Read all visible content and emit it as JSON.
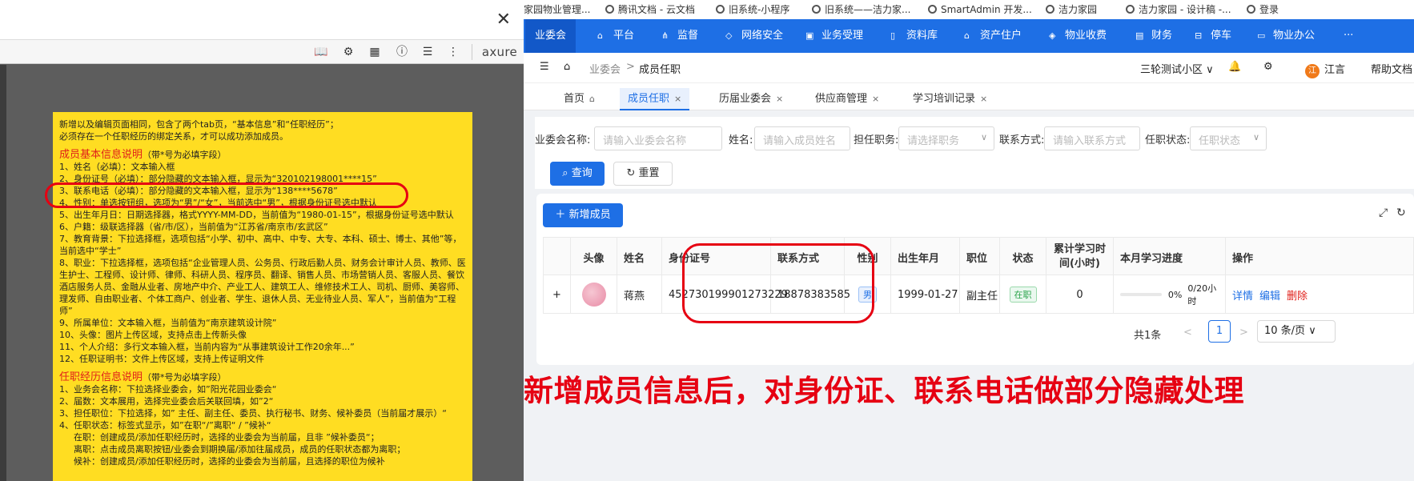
{
  "left": {
    "close_glyph": "✕",
    "toolbar_icons": [
      "book-icon",
      "settings-icon",
      "grid-icon",
      "info-icon",
      "list-icon",
      "more-icon"
    ],
    "brand": "axure",
    "note": {
      "intro1": "新增以及编辑页面相同，包含了两个tab页，“基本信息”和“任职经历”；",
      "intro2": "必须存在一个任职经历的绑定关系，才可以成功添加成员。",
      "h1": "成员基本信息说明",
      "h1_small": "（带*号为必填字段）",
      "items1": [
        "1、姓名（必填）：文本输入框",
        "2、身份证号（必填）：部分隐藏的文本输入框，显示为“320102198001****15”",
        "3、联系电话（必填）：部分隐藏的文本输入框，显示为“138****5678”",
        "4、性别：单选按钮组，选项为“男”/“女”，当前选中“男”，根据身份证号选中默认",
        "5、出生年月日：日期选择器，格式YYYY-MM-DD，当前值为“1980-01-15”，根据身份证号选中默认",
        "6、户籍：级联选择器（省/市/区），当前值为“江苏省/南京市/玄武区”",
        "7、教育背景：下拉选择框，选项包括“小学、初中、高中、中专、大专、本科、硕士、博士、其他”等，当前选中“学士”",
        "8、职业：下拉选择框，选项包括“企业管理人员、公务员、行政后勤人员、财务会计审计人员、教师、医生护士、工程师、设计师、律师、科研人员、程序员、翻译、销售人员、市场营销人员、客服人员、餐饮酒店服务人员、金融从业者、房地产中介、产业工人、建筑工人、维修技术工人、司机、厨师、美容师、理发师、自由职业者、个体工商户、创业者、学生、退休人员、无业待业人员、军人”，当前值为“工程师”",
        "9、所属单位：文本输入框，当前值为“南京建筑设计院”",
        "10、头像：图片上传区域，支持点击上传新头像",
        "11、个人介绍：多行文本输入框，当前内容为“从事建筑设计工作20余年...”",
        "12、任职证明书：文件上传区域，支持上传证明文件"
      ],
      "h2": "任职经历信息说明",
      "h2_small": "（带*号为必填字段）",
      "items2": [
        "1、业务会名称：下拉选择业委会，如”阳光花园业委会“",
        "2、届数：文本展用，选择完业委会后关联回填，如”2“",
        "3、担任职位：下拉选择，如” 主任、副主任、委员、执行秘书、财务、候补委员（当前届才展示）“",
        "4、任职状态：标签式显示，如”在职“/”离职“ / ”候补“",
        "在职：创建成员/添加任职经历时，选择的业委会为当前届，且非 ”候补委员“；",
        "离职：点击成员离职按钮/业委会到期换届/添加往届成员，成员的任职状态都为离职；",
        "候补：创建成员/添加任职经历时，选择的业委会为当前届，且选择的职位为候补"
      ]
    }
  },
  "right": {
    "bookmarks": [
      "家园物业管理...",
      "腾讯文档 - 云文档",
      "旧系统-小程序",
      "旧系统——洁力家...",
      "SmartAdmin 开发...",
      "洁力家园",
      "洁力家园 - 设计稿 -...",
      "登录"
    ],
    "nav": [
      {
        "label": "业委会",
        "icon": ""
      },
      {
        "label": "平台",
        "icon": "bank-icon"
      },
      {
        "label": "监督",
        "icon": "share-icon"
      },
      {
        "label": "网络安全",
        "icon": "shield-icon"
      },
      {
        "label": "业务受理",
        "icon": "camera-icon"
      },
      {
        "label": "资料库",
        "icon": "doc-icon"
      },
      {
        "label": "资产住户",
        "icon": "home-icon"
      },
      {
        "label": "物业收费",
        "icon": "wallet-icon"
      },
      {
        "label": "财务",
        "icon": "calc-icon"
      },
      {
        "label": "停车",
        "icon": "car-icon"
      },
      {
        "label": "物业办公",
        "icon": "monitor-icon"
      },
      {
        "label": "···",
        "icon": ""
      }
    ],
    "breadcrumb": {
      "parent": "业委会",
      "sep": ">",
      "current": "成员任职"
    },
    "community": "三轮测试小区",
    "user_initial": "江",
    "user_name": "江言",
    "help": "帮助文档",
    "tabs": [
      {
        "label": "首页",
        "close": "⌂"
      },
      {
        "label": "成员任职",
        "close": "×"
      },
      {
        "label": "历届业委会",
        "close": "×"
      },
      {
        "label": "供应商管理",
        "close": "×"
      },
      {
        "label": "学习培训记录",
        "close": "×"
      }
    ],
    "filter": {
      "f1_label": "业委会名称:",
      "f1_ph": "请输入业委会名称",
      "f2_label": "姓名:",
      "f2_ph": "请输入成员姓名",
      "f3_label": "担任职务:",
      "f3_ph": "请选择职务",
      "f4_label": "联系方式:",
      "f4_ph": "请输入联系方式",
      "f5_label": "任职状态:",
      "f5_ph": "任职状态",
      "search": "查询",
      "reset": "重置"
    },
    "add_button": "新增成员",
    "table": {
      "headers": [
        "头像",
        "姓名",
        "身份证号",
        "联系方式",
        "性别",
        "出生年月",
        "职位",
        "状态",
        "累计学习时间(小时)",
        "本月学习进度",
        "操作"
      ],
      "row": {
        "expand": "+",
        "name": "蒋燕",
        "id_card": "452730199901273229",
        "phone": "18878383585",
        "gender": "男",
        "birth": "1999-01-27",
        "position": "副主任",
        "status": "在职",
        "study_hours": "0",
        "progress_pct": "0%",
        "progress_text": "0/20小时",
        "actions": [
          "详情",
          "编辑",
          "删除"
        ]
      }
    },
    "pager": {
      "total": "共1条",
      "prev": "<",
      "current": "1",
      "next": ">",
      "size": "10 条/页"
    },
    "caption": "新增成员信息后，对身份证、联系电话做部分隐藏处理",
    "colors": {
      "primary": "#1e6fe5",
      "annotation": "#e60012",
      "note_bg": "#ffdd22"
    }
  }
}
